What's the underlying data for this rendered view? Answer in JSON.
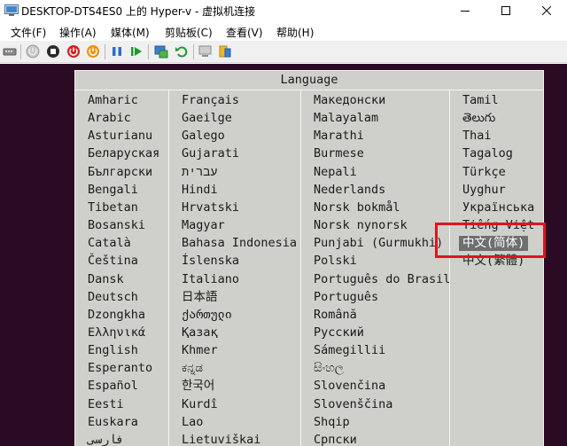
{
  "window": {
    "title": "DESKTOP-DTS4ES0 上的 Hyper-v - 虚拟机连接"
  },
  "menu": {
    "items": [
      "文件(F)",
      "操作(A)",
      "媒体(M)",
      "剪贴板(C)",
      "查看(V)",
      "帮助(H)"
    ]
  },
  "toolbar": {
    "icons": [
      "ctrl-alt-del-icon",
      "start-icon",
      "turn-off-icon",
      "shut-down-icon",
      "save-icon",
      "pause-icon",
      "resume-icon",
      "checkpoint-icon",
      "revert-icon",
      "enhanced-session-icon",
      "share-icon"
    ]
  },
  "language_dialog": {
    "title": "Language",
    "columns": [
      [
        "Amharic",
        "Arabic",
        "Asturianu",
        "Беларуская",
        "Български",
        "Bengali",
        "Tibetan",
        "Bosanski",
        "Català",
        "Čeština",
        "Dansk",
        "Deutsch",
        "Dzongkha",
        "Ελληνικά",
        "English",
        "Esperanto",
        "Español",
        "Eesti",
        "Euskara",
        "فارسی"
      ],
      [
        "Français",
        "Gaeilge",
        "Galego",
        "Gujarati",
        "עברית",
        "Hindi",
        "Hrvatski",
        "Magyar",
        "Bahasa Indonesia",
        "Íslenska",
        "Italiano",
        "日本語",
        "ქართული",
        "Қазақ",
        "Khmer",
        "ಕನ್ನಡ",
        "한국어",
        "Kurdî",
        "Lao",
        "Lietuviškai"
      ],
      [
        "Македонски",
        "Malayalam",
        "Marathi",
        "Burmese",
        "Nepali",
        "Nederlands",
        "Norsk bokmål",
        "Norsk nynorsk",
        "Punjabi (Gurmukhi)",
        "Polski",
        "Português do Brasil",
        "Português",
        "Română",
        "Русский",
        "Sámegillii",
        "සිංහල",
        "Slovenčina",
        "Slovenščina",
        "Shqip",
        "Српски"
      ],
      [
        "Tamil",
        "తెలుగు",
        "Thai",
        "Tagalog",
        "Türkçe",
        "Uyghur",
        "Українська",
        "Tiếng Việt",
        "中文(简体)",
        "中文(繁體)"
      ]
    ],
    "selected": "中文(简体)"
  }
}
